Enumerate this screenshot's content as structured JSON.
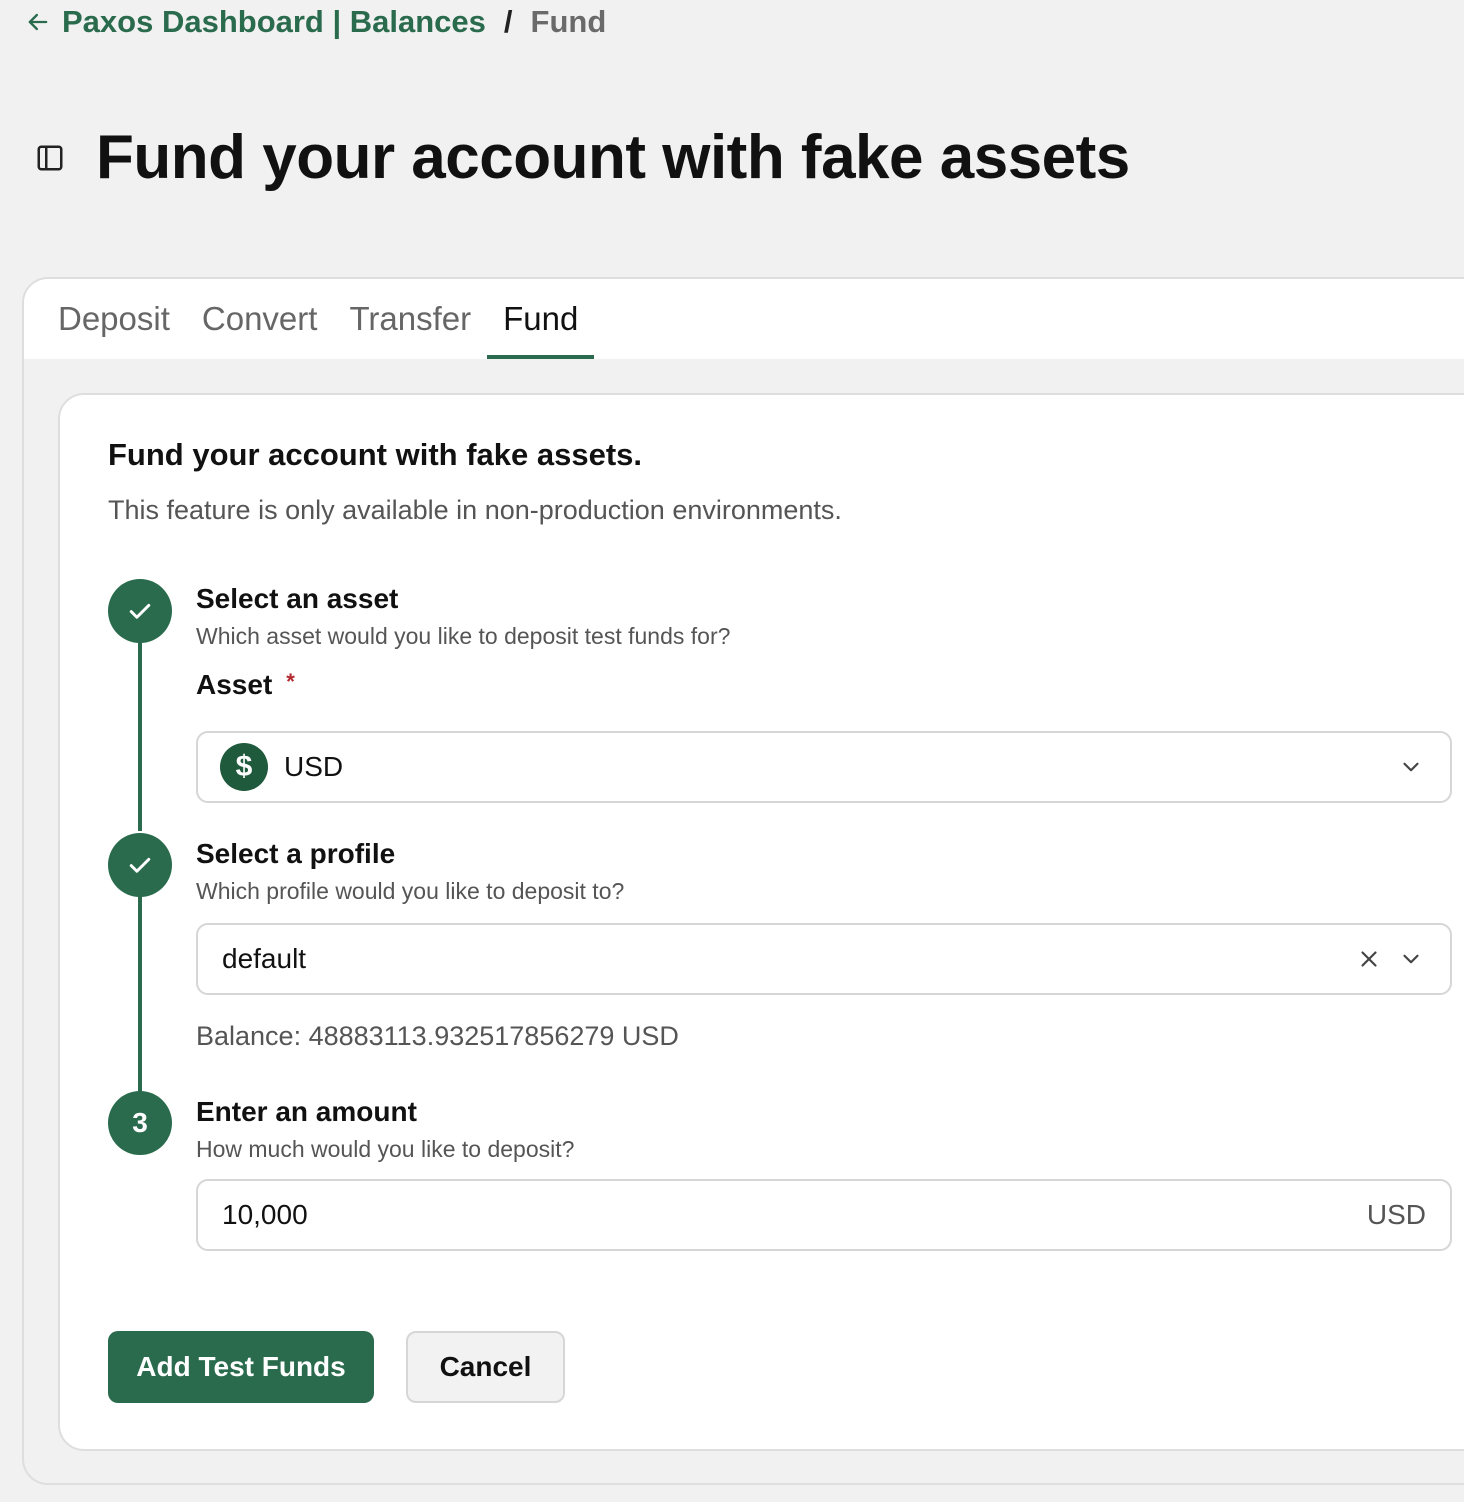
{
  "breadcrumb": {
    "parent": "Paxos Dashboard | Balances",
    "separator": "/",
    "current": "Fund"
  },
  "page": {
    "title": "Fund your account with fake assets"
  },
  "tabs": [
    {
      "label": "Deposit",
      "active": false
    },
    {
      "label": "Convert",
      "active": false
    },
    {
      "label": "Transfer",
      "active": false
    },
    {
      "label": "Fund",
      "active": true
    }
  ],
  "card": {
    "title": "Fund your account with fake assets.",
    "subtitle": "This feature is only available in non-production environments."
  },
  "steps": [
    {
      "marker": "check",
      "title": "Select an asset",
      "description": "Which asset would you like to deposit test funds for?"
    },
    {
      "marker": "check",
      "title": "Select a profile",
      "description": "Which profile would you like to deposit to?"
    },
    {
      "marker": "3",
      "title": "Enter an amount",
      "description": "How much would you like to deposit?"
    }
  ],
  "asset_field": {
    "label": "Asset",
    "required_mark": "*",
    "icon_symbol": "$",
    "value": "USD"
  },
  "profile_field": {
    "value": "default"
  },
  "balance": {
    "text": "Balance: 48883113.932517856279 USD"
  },
  "amount_field": {
    "value": "10,000",
    "unit": "USD"
  },
  "actions": {
    "submit_label": "Add Test Funds",
    "cancel_label": "Cancel"
  },
  "colors": {
    "accent": "#2a6b4d",
    "required": "#b3262d",
    "background": "#f1f1f1"
  },
  "icons": [
    "arrow-left-icon",
    "sidebar-toggle-icon",
    "check-icon",
    "dollar-icon",
    "chevron-down-icon",
    "close-icon"
  ]
}
